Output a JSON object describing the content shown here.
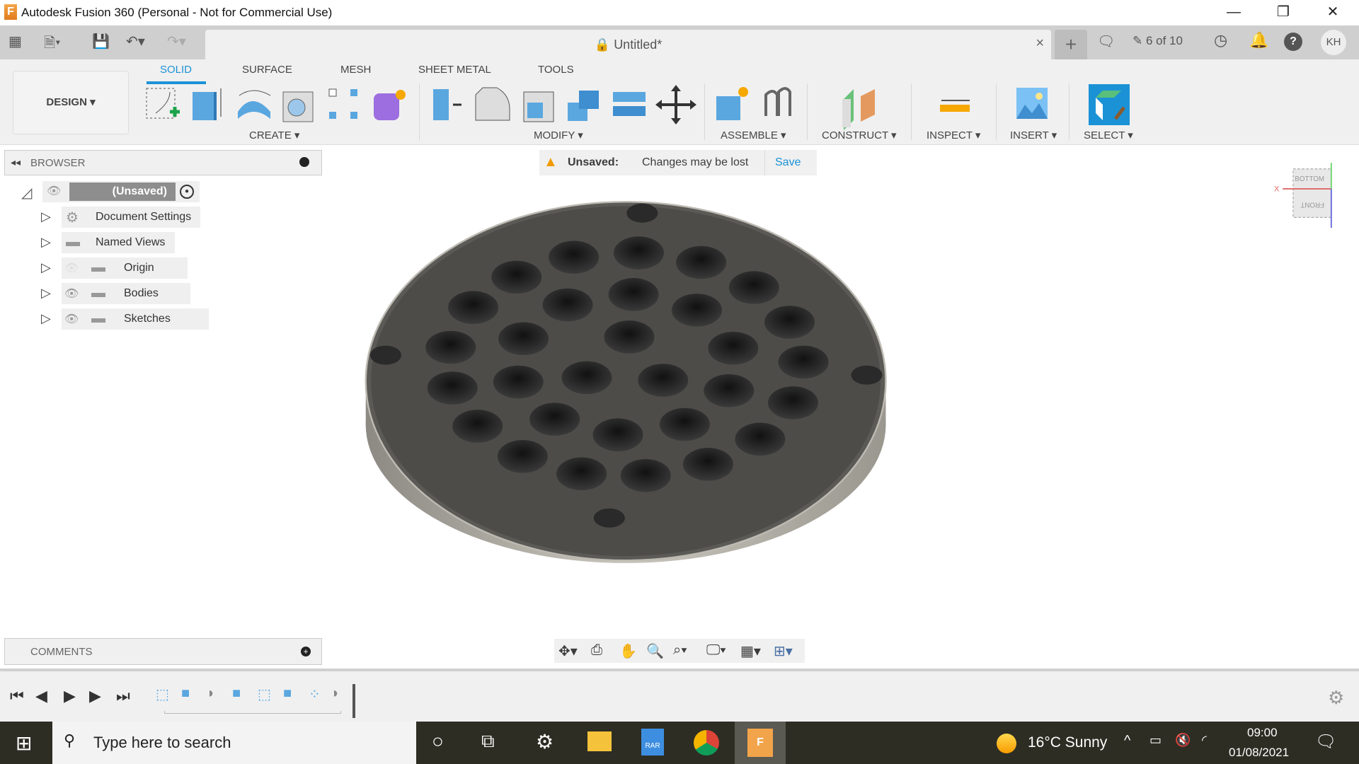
{
  "window": {
    "title": "Autodesk Fusion 360 (Personal - Not for Commercial Use)",
    "app_icon_letter": "F",
    "minimize": "—",
    "restore": "❐",
    "close": "✕"
  },
  "tabbar": {
    "doc_title": "Untitled*",
    "close": "×",
    "new_tab": "+",
    "jobs": "6 of 10",
    "avatar": "KH"
  },
  "toolbar": {
    "workspace": "DESIGN ▾",
    "tabs": [
      {
        "label": "SOLID",
        "active": true
      },
      {
        "label": "SURFACE"
      },
      {
        "label": "MESH"
      },
      {
        "label": "SHEET METAL"
      },
      {
        "label": "TOOLS"
      }
    ],
    "groups": {
      "create": "CREATE ▾",
      "modify": "MODIFY ▾",
      "assemble": "ASSEMBLE ▾",
      "construct": "CONSTRUCT ▾",
      "inspect": "INSPECT ▾",
      "insert": "INSERT ▾",
      "select": "SELECT ▾"
    },
    "accent": "#1b92d6"
  },
  "browser": {
    "title": "BROWSER",
    "root": "(Unsaved)",
    "items": [
      {
        "label": "Document Settings",
        "icon": "gear-icon"
      },
      {
        "label": "Named Views",
        "icon": "folder-icon"
      },
      {
        "label": "Origin",
        "icon": "folder-icon",
        "visible": false
      },
      {
        "label": "Bodies",
        "icon": "folder-icon",
        "visible": true
      },
      {
        "label": "Sketches",
        "icon": "folder-icon",
        "visible": true
      }
    ]
  },
  "unsaved_bar": {
    "status": "Unsaved:",
    "message": "Changes may be lost",
    "save": "Save"
  },
  "viewcube": {
    "top": "BOTTOM",
    "front": "FRONT",
    "x_axis": "X"
  },
  "comments": {
    "title": "COMMENTS"
  },
  "taskbar": {
    "search_placeholder": "Type here to search",
    "weather": "16°C  Sunny",
    "time": "09:00",
    "date": "01/08/2021"
  }
}
